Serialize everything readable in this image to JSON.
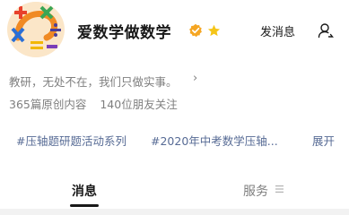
{
  "account": {
    "name": "爱数学做数学",
    "intro": "教研，无处不在，我们只做实事。",
    "verify_color": "#f5a623",
    "star_color": "#f5c518"
  },
  "header": {
    "send_message_label": "发消息"
  },
  "stats": {
    "articles": "365篇原创内容",
    "followers": "140位朋友关注"
  },
  "tags": [
    "#压轴题研题活动系列",
    "#2020年中考数学压轴..."
  ],
  "expand_label": "展开",
  "tabs": [
    {
      "label": "消息",
      "active": true
    },
    {
      "label": "服务",
      "active": false
    }
  ],
  "icons": {
    "verify": "verified-badge-icon",
    "star": "star-icon",
    "profile": "user-icon",
    "intro_arrow": "chevron-right-icon",
    "services_menu": "menu-lines-icon"
  }
}
